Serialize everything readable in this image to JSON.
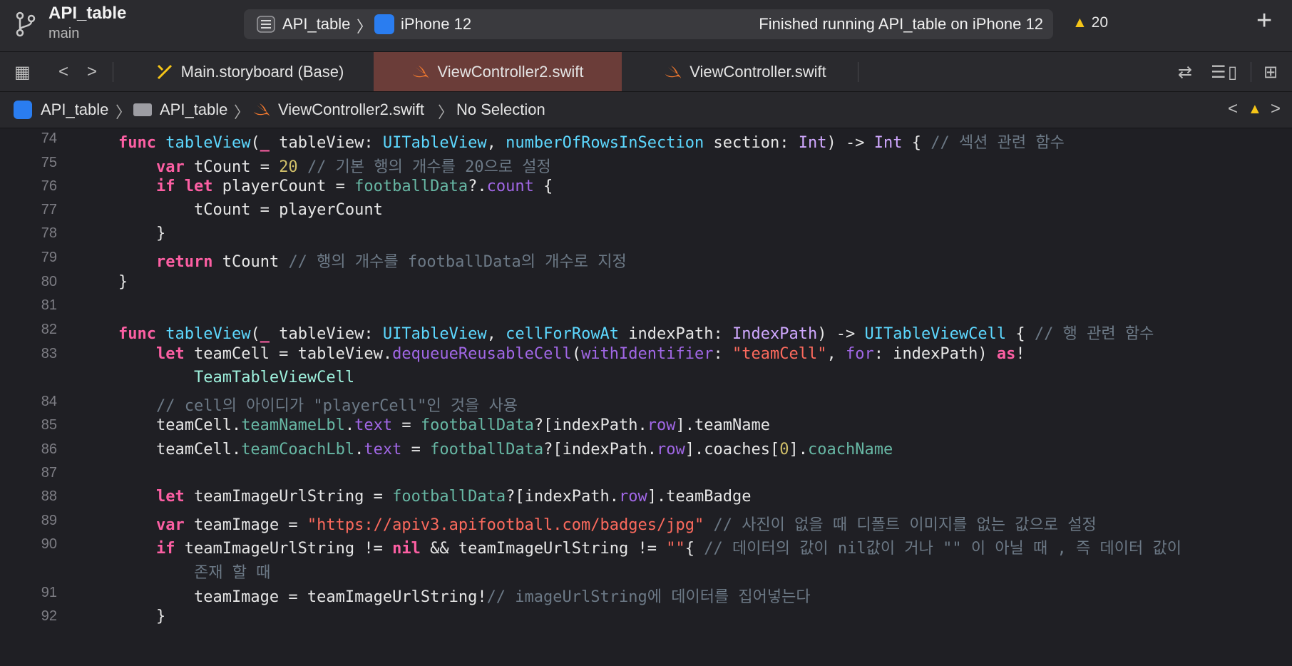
{
  "window": {
    "project_name": "API_table",
    "branch": "main",
    "scheme_target": "API_table",
    "scheme_device": "iPhone 12",
    "status": "Finished running API_table on iPhone 12",
    "warning_count": "20"
  },
  "tabs": [
    {
      "label": "Main.storyboard (Base)",
      "active": false
    },
    {
      "label": "ViewController2.swift",
      "active": true
    },
    {
      "label": "ViewController.swift",
      "active": false
    }
  ],
  "jumpbar": {
    "items": [
      "API_table",
      "API_table",
      "ViewController2.swift",
      "No Selection"
    ]
  },
  "colors": {
    "keyword": "#fc5fa3",
    "type": "#5dd8ff",
    "comment": "#6c7986",
    "string": "#fc6a5d",
    "number": "#d0bf69",
    "active_tab": "#6b3d39"
  },
  "editor": {
    "lines": [
      {
        "num": "74",
        "tokens": [
          [
            "k",
            "func"
          ],
          [
            "d",
            " "
          ],
          [
            "t",
            "tableView"
          ],
          [
            "d",
            "("
          ],
          [
            "k",
            "_"
          ],
          [
            "d",
            " tableView: "
          ],
          [
            "t",
            "UITableView"
          ],
          [
            "d",
            ", "
          ],
          [
            "t",
            "numberOfRowsInSection"
          ],
          [
            "d",
            " section: "
          ],
          [
            "cl",
            "Int"
          ],
          [
            "d",
            ") -> "
          ],
          [
            "cl",
            "Int"
          ],
          [
            "d",
            " { "
          ],
          [
            "c",
            "// 섹션 관련 함수"
          ]
        ]
      },
      {
        "num": "75",
        "tokens": [
          [
            "d",
            "    "
          ],
          [
            "k",
            "var"
          ],
          [
            "d",
            " tCount = "
          ],
          [
            "n",
            "20"
          ],
          [
            "d",
            " "
          ],
          [
            "c",
            "// 기본 행의 개수를 20으로 설정"
          ]
        ]
      },
      {
        "num": "76",
        "tokens": [
          [
            "d",
            "    "
          ],
          [
            "k",
            "if"
          ],
          [
            "d",
            " "
          ],
          [
            "k",
            "let"
          ],
          [
            "d",
            " playerCount = "
          ],
          [
            "f",
            "footballData"
          ],
          [
            "d",
            "?."
          ],
          [
            "p",
            "count"
          ],
          [
            "d",
            " {"
          ]
        ]
      },
      {
        "num": "77",
        "tokens": [
          [
            "d",
            "        tCount = playerCount"
          ]
        ]
      },
      {
        "num": "78",
        "tokens": [
          [
            "d",
            "    }"
          ]
        ]
      },
      {
        "num": "79",
        "tokens": [
          [
            "d",
            "    "
          ],
          [
            "k",
            "return"
          ],
          [
            "d",
            " tCount "
          ],
          [
            "c",
            "// 행의 개수를 footballData의 개수로 지정"
          ]
        ]
      },
      {
        "num": "80",
        "tokens": [
          [
            "d",
            "}"
          ]
        ]
      },
      {
        "num": "81",
        "tokens": []
      },
      {
        "num": "82",
        "tokens": [
          [
            "k",
            "func"
          ],
          [
            "d",
            " "
          ],
          [
            "t",
            "tableView"
          ],
          [
            "d",
            "("
          ],
          [
            "k",
            "_"
          ],
          [
            "d",
            " tableView: "
          ],
          [
            "t",
            "UITableView"
          ],
          [
            "d",
            ", "
          ],
          [
            "t",
            "cellForRowAt"
          ],
          [
            "d",
            " indexPath: "
          ],
          [
            "cl",
            "IndexPath"
          ],
          [
            "d",
            ") -> "
          ],
          [
            "t",
            "UITableViewCell"
          ],
          [
            "d",
            " { "
          ],
          [
            "c",
            "// 행 관련 함수"
          ]
        ]
      },
      {
        "num": "83",
        "tokens": [
          [
            "d",
            "    "
          ],
          [
            "k",
            "let"
          ],
          [
            "d",
            " teamCell = tableView."
          ],
          [
            "p",
            "dequeueReusableCell"
          ],
          [
            "d",
            "("
          ],
          [
            "p",
            "withIdentifier"
          ],
          [
            "d",
            ": "
          ],
          [
            "s",
            "\"teamCell\""
          ],
          [
            "d",
            ", "
          ],
          [
            "p",
            "for"
          ],
          [
            "d",
            ": indexPath) "
          ],
          [
            "k",
            "as"
          ],
          [
            "d",
            "!"
          ]
        ]
      },
      {
        "num": "",
        "tokens": [
          [
            "d",
            "        "
          ],
          [
            "ty",
            "TeamTableViewCell"
          ]
        ]
      },
      {
        "num": "84",
        "tokens": [
          [
            "d",
            "    "
          ],
          [
            "c",
            "// cell의 아이디가 \"playerCell\"인 것을 사용"
          ]
        ]
      },
      {
        "num": "85",
        "tokens": [
          [
            "d",
            "    teamCell."
          ],
          [
            "f",
            "teamNameLbl"
          ],
          [
            "d",
            "."
          ],
          [
            "p",
            "text"
          ],
          [
            "d",
            " = "
          ],
          [
            "f",
            "footballData"
          ],
          [
            "d",
            "?[indexPath."
          ],
          [
            "p",
            "row"
          ],
          [
            "d",
            "].teamName"
          ]
        ]
      },
      {
        "num": "86",
        "tokens": [
          [
            "d",
            "    teamCell."
          ],
          [
            "f",
            "teamCoachLbl"
          ],
          [
            "d",
            "."
          ],
          [
            "p",
            "text"
          ],
          [
            "d",
            " = "
          ],
          [
            "f",
            "footballData"
          ],
          [
            "d",
            "?[indexPath."
          ],
          [
            "p",
            "row"
          ],
          [
            "d",
            "].coaches["
          ],
          [
            "n",
            "0"
          ],
          [
            "d",
            "]."
          ],
          [
            "f",
            "coachName"
          ]
        ]
      },
      {
        "num": "87",
        "tokens": []
      },
      {
        "num": "88",
        "tokens": [
          [
            "d",
            "    "
          ],
          [
            "k",
            "let"
          ],
          [
            "d",
            " teamImageUrlString = "
          ],
          [
            "f",
            "footballData"
          ],
          [
            "d",
            "?[indexPath."
          ],
          [
            "p",
            "row"
          ],
          [
            "d",
            "].teamBadge"
          ]
        ]
      },
      {
        "num": "89",
        "tokens": [
          [
            "d",
            "    "
          ],
          [
            "k",
            "var"
          ],
          [
            "d",
            " teamImage = "
          ],
          [
            "s",
            "\"https://apiv3.apifootball.com/badges/jpg\""
          ],
          [
            "d",
            " "
          ],
          [
            "c",
            "// 사진이 없을 때 디폴트 이미지를 없는 값으로 설정"
          ]
        ]
      },
      {
        "num": "90",
        "tokens": [
          [
            "d",
            "    "
          ],
          [
            "k",
            "if"
          ],
          [
            "d",
            " teamImageUrlString != "
          ],
          [
            "k",
            "nil"
          ],
          [
            "d",
            " && teamImageUrlString != "
          ],
          [
            "s",
            "\"\""
          ],
          [
            "d",
            "{ "
          ],
          [
            "c",
            "// 데이터의 값이 nil값이 거나 \"\" 이 아닐 때 , 즉 데이터 값이"
          ]
        ]
      },
      {
        "num": "",
        "tokens": [
          [
            "d",
            "        "
          ],
          [
            "c",
            "존재 할 때"
          ]
        ]
      },
      {
        "num": "91",
        "tokens": [
          [
            "d",
            "        teamImage = teamImageUrlString!"
          ],
          [
            "c",
            "// imageUrlString에 데이터를 집어넣는다"
          ]
        ]
      },
      {
        "num": "92",
        "tokens": [
          [
            "d",
            "    }"
          ]
        ]
      }
    ]
  }
}
